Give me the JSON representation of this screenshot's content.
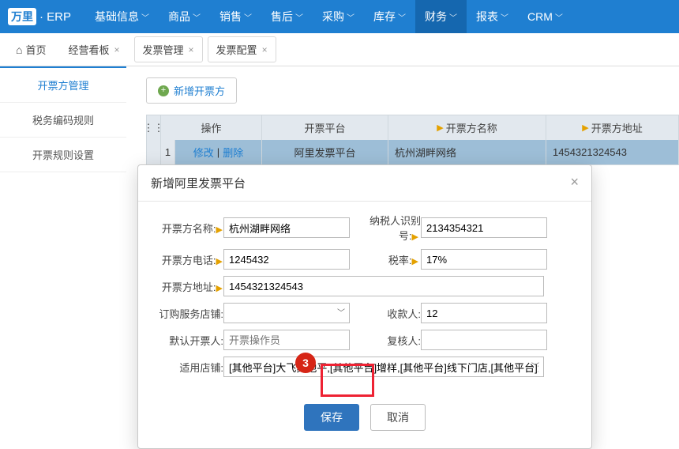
{
  "brand": {
    "logo_text": "万里",
    "suffix": "· ERP"
  },
  "topnav": [
    {
      "label": "基础信息"
    },
    {
      "label": "商品"
    },
    {
      "label": "销售"
    },
    {
      "label": "售后"
    },
    {
      "label": "采购"
    },
    {
      "label": "库存"
    },
    {
      "label": "财务",
      "active": true
    },
    {
      "label": "报表"
    },
    {
      "label": "CRM"
    }
  ],
  "tabs": {
    "home": "首页",
    "items": [
      {
        "label": "经营看板"
      },
      {
        "label": "发票管理",
        "boxed": true
      },
      {
        "label": "发票配置",
        "boxed": true
      }
    ]
  },
  "sidenav": [
    {
      "label": "开票方管理",
      "active": true
    },
    {
      "label": "税务编码规则"
    },
    {
      "label": "开票规则设置"
    }
  ],
  "toolbar": {
    "add_label": "新增开票方"
  },
  "grid": {
    "headers": {
      "op": "操作",
      "platform": "开票平台",
      "name": "开票方名称",
      "addr": "开票方地址"
    },
    "rows": [
      {
        "idx": "1",
        "edit": "修改",
        "sep": "|",
        "del": "删除",
        "platform": "阿里发票平台",
        "name": "杭州湖畔网络",
        "addr": "1454321324543"
      }
    ]
  },
  "modal": {
    "title": "新增阿里发票平台",
    "labels": {
      "name": "开票方名称:",
      "taxid": "纳税人识别号:",
      "phone": "开票方电话:",
      "rate": "税率:",
      "addr": "开票方地址:",
      "shop": "订购服务店铺:",
      "payee": "收款人:",
      "issuer": "默认开票人:",
      "reviewer": "复核人:",
      "applicable": "适用店铺:"
    },
    "values": {
      "name": "杭州湖畔网络",
      "taxid": "2134354321",
      "phone": "1245432",
      "rate": "17%",
      "addr": "1454321324543",
      "shop": "",
      "payee": "12",
      "issuer": "",
      "reviewer": "",
      "applicable": "[其他平台]大飞其他平,[其他平台]增样,[其他平台]线下门店,[其他平台]测试线"
    },
    "placeholders": {
      "issuer": "开票操作员"
    },
    "buttons": {
      "save": "保存",
      "cancel": "取消"
    },
    "step_badge": "3"
  }
}
